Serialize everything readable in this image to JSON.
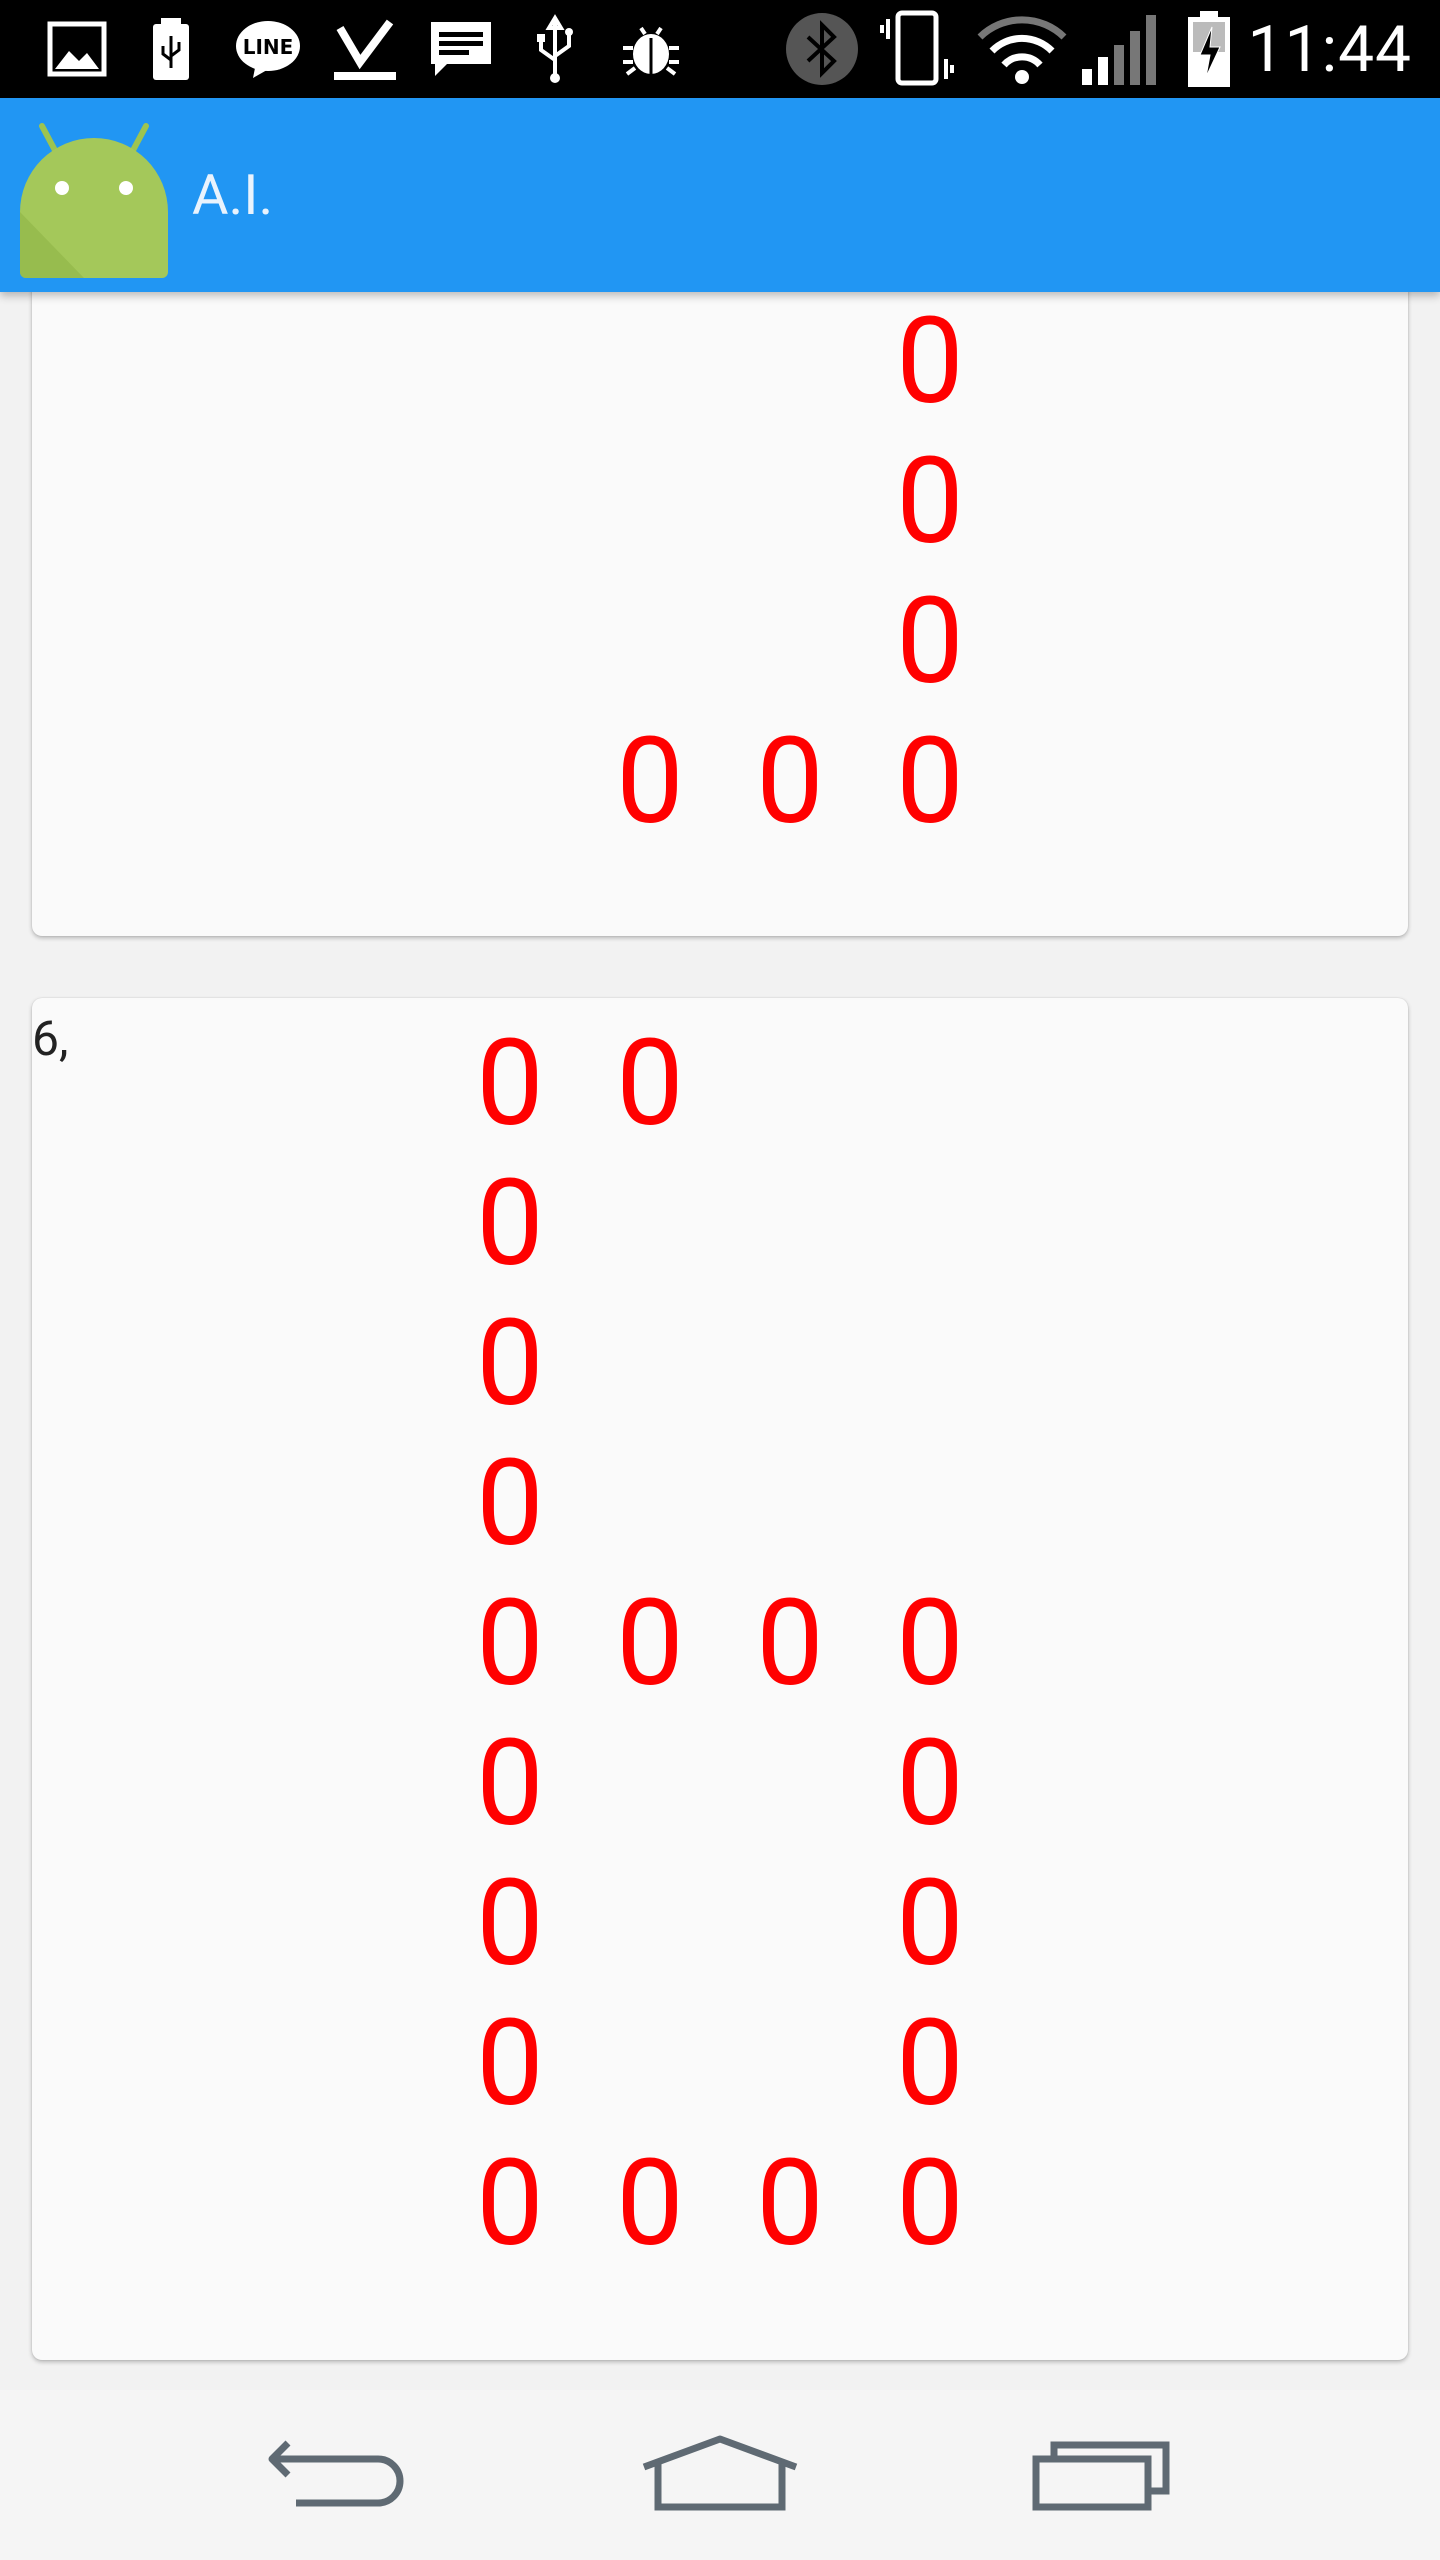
{
  "status_bar": {
    "time": "11:44",
    "left_icons": [
      "gallery-icon",
      "usb-icon",
      "line-icon",
      "download-done-icon",
      "message-icon",
      "usb-debug-icon",
      "bug-icon"
    ],
    "right_icons": [
      "bluetooth-icon",
      "vibrate-icon",
      "wifi-icon",
      "signal-icon",
      "battery-charging-icon"
    ]
  },
  "action_bar": {
    "title": "A.I.",
    "color": "#2196f3",
    "logo_icon": "android-robot-icon"
  },
  "cards": [
    {
      "label": "",
      "cells": [
        {
          "row": 0,
          "col": 3,
          "text": "0"
        },
        {
          "row": 1,
          "col": 3,
          "text": "0"
        },
        {
          "row": 2,
          "col": 3,
          "text": "0"
        },
        {
          "row": 3,
          "col": 1,
          "text": "0"
        },
        {
          "row": 3,
          "col": 2,
          "text": "0"
        },
        {
          "row": 3,
          "col": 3,
          "text": "0"
        }
      ]
    },
    {
      "label": "6,",
      "cells": [
        {
          "row": 0,
          "col": 0,
          "text": "0"
        },
        {
          "row": 0,
          "col": 1,
          "text": "0"
        },
        {
          "row": 1,
          "col": 0,
          "text": "0"
        },
        {
          "row": 2,
          "col": 0,
          "text": "0"
        },
        {
          "row": 3,
          "col": 0,
          "text": "0"
        },
        {
          "row": 4,
          "col": 0,
          "text": "0"
        },
        {
          "row": 4,
          "col": 1,
          "text": "0"
        },
        {
          "row": 4,
          "col": 2,
          "text": "0"
        },
        {
          "row": 4,
          "col": 3,
          "text": "0"
        },
        {
          "row": 5,
          "col": 0,
          "text": "0"
        },
        {
          "row": 5,
          "col": 3,
          "text": "0"
        },
        {
          "row": 6,
          "col": 0,
          "text": "0"
        },
        {
          "row": 6,
          "col": 3,
          "text": "0"
        },
        {
          "row": 7,
          "col": 0,
          "text": "0"
        },
        {
          "row": 7,
          "col": 3,
          "text": "0"
        },
        {
          "row": 8,
          "col": 0,
          "text": "0"
        },
        {
          "row": 8,
          "col": 1,
          "text": "0"
        },
        {
          "row": 8,
          "col": 2,
          "text": "0"
        },
        {
          "row": 8,
          "col": 3,
          "text": "0"
        }
      ]
    }
  ],
  "cell_color": "#ff0000",
  "nav_bar": {
    "buttons": [
      "back-icon",
      "home-icon",
      "recent-apps-icon"
    ]
  }
}
